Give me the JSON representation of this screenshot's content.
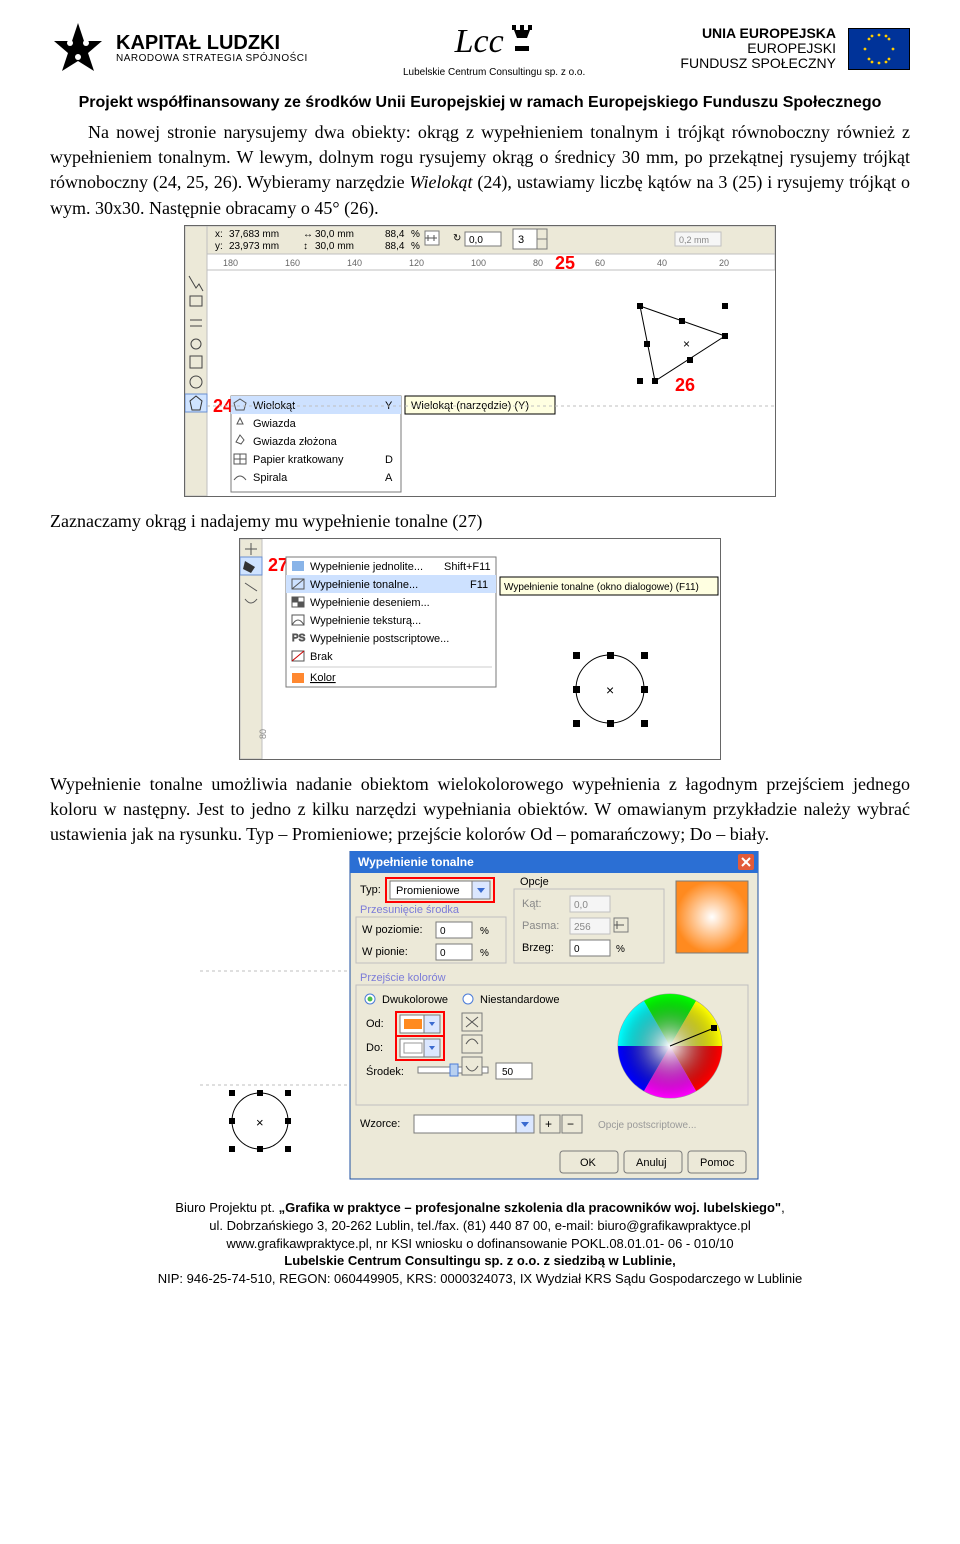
{
  "header": {
    "kl_title": "KAPITAŁ LUDZKI",
    "kl_subtitle": "NARODOWA STRATEGIA SPÓJNOŚCI",
    "lcc_script": "Lcc",
    "lcc_caption": "Lubelskie Centrum Consultingu sp. z o.o.",
    "ue_line1": "UNIA EUROPEJSKA",
    "ue_line2": "EUROPEJSKI",
    "ue_line3": "FUNDUSZ SPOŁECZNY"
  },
  "project_line": "Projekt współfinansowany ze środków Unii Europejskiej w ramach Europejskiego Funduszu Społecznego",
  "para1": "Na nowej stronie narysujemy dwa obiekty: okrąg z wypełnieniem tonalnym i trójkąt równoboczny również z wypełnieniem tonalnym. W lewym, dolnym rogu rysujemy okrąg o średnicy 30 mm, po przekątnej rysujemy trójkąt równoboczny (24, 25, 26). Wybieramy narzędzie ",
  "para1_it": "Wielokąt",
  "para1b": " (24), ustawiamy liczbę kątów na 3 (25) i rysujemy trójkąt o wym. 30x30. Następnie obracamy o 45° (26).",
  "l24": "24",
  "l25": "25",
  "l26": "26",
  "l27": "27",
  "para2": "Zaznaczamy okrąg i nadajemy mu wypełnienie tonalne (27)",
  "para3": "Wypełnienie tonalne umożliwia nadanie obiektom wielokolorowego wypełnienia z łagodnym przejściem jednego koloru w następny. Jest to jedno z kilku narzędzi wypełniania obiektów. W omawianym przykładzie należy wybrać ustawienia jak na rysunku. Typ – Promieniowe; przejście kolorów Od – pomarańczowy; Do – biały.",
  "dlg": {
    "title": "Wypełnienie tonalne",
    "typ_label": "Typ:",
    "typ_value": "Promieniowe",
    "opcje": "Opcje",
    "presun": "Przesunięcie środka",
    "kat": "Kąt:",
    "kat_v": "0,0",
    "poziom": "W poziomie:",
    "poziom_v": "0",
    "pct": "%",
    "pion": "W pionie:",
    "pion_v": "0",
    "pasma": "Pasma:",
    "pasma_v": "256",
    "brzeg": "Brzeg:",
    "brzeg_v": "0",
    "przej": "Przejście kolorów",
    "dwuk": "Dwukolorowe",
    "niest": "Niestandardowe",
    "od": "Od:",
    "do": "Do:",
    "srodek": "Środek:",
    "srodek_v": "50",
    "wzorce": "Wzorce:",
    "opcjeps": "Opcje postscriptowe...",
    "ok": "OK",
    "anuluj": "Anuluj",
    "pomoc": "Pomoc"
  },
  "fly24": {
    "i1": "Wielokąt",
    "k1": "Y",
    "tip": "Wielokąt (narzędzie) (Y)",
    "i2": "Gwiazda",
    "i3": "Gwiazda złożona",
    "i4": "Papier kratkowany",
    "k4": "D",
    "i5": "Spirala",
    "k5": "A"
  },
  "fly27": {
    "i1": "Wypełnienie jednolite...",
    "k1": "Shift+F11",
    "i2": "Wypełnienie tonalne...",
    "k2": "F11",
    "tip": "Wypełnienie tonalne (okno dialogowe) (F11)",
    "i3": "Wypełnienie deseniem...",
    "i4": "Wypełnienie teksturą...",
    "i5": "Wypełnienie postscriptowe...",
    "i6": "Brak",
    "i7": "Kolor"
  },
  "prop": {
    "x": "37,683 mm",
    "y": "23,973 mm",
    "w": "30,0 mm",
    "h": "30,0 mm",
    "sx": "88,4",
    "sy": "88,4",
    "rot": "0,0",
    "stroke": "0,2 mm"
  },
  "ruler": {
    "t180": "180",
    "t160": "160",
    "t140": "140",
    "t120": "120",
    "t100": "100",
    "t80": "80",
    "t60": "60",
    "t40": "40",
    "t20": "20"
  },
  "footer": {
    "l1a": "Biuro Projektu pt. ",
    "l1b": "„Grafika w praktyce – profesjonalne szkolenia dla pracowników woj. lubelskiego\"",
    "l1c": ",",
    "l2": "ul. Dobrzańskiego 3, 20-262 Lublin, tel./fax. (81) 440 87 00, e-mail: biuro@grafikawpraktyce.pl",
    "l3": "www.grafikawpraktyce.pl, nr KSI wniosku o dofinansowanie POKL.08.01.01- 06 - 010/10",
    "l4": "Lubelskie Centrum Consultingu sp. z o.o. z siedzibą w Lublinie,",
    "l5": "NIP: 946-25-74-510, REGON: 060449905, KRS: 0000324073, IX Wydział KRS Sądu Gospodarczego w Lublinie"
  }
}
